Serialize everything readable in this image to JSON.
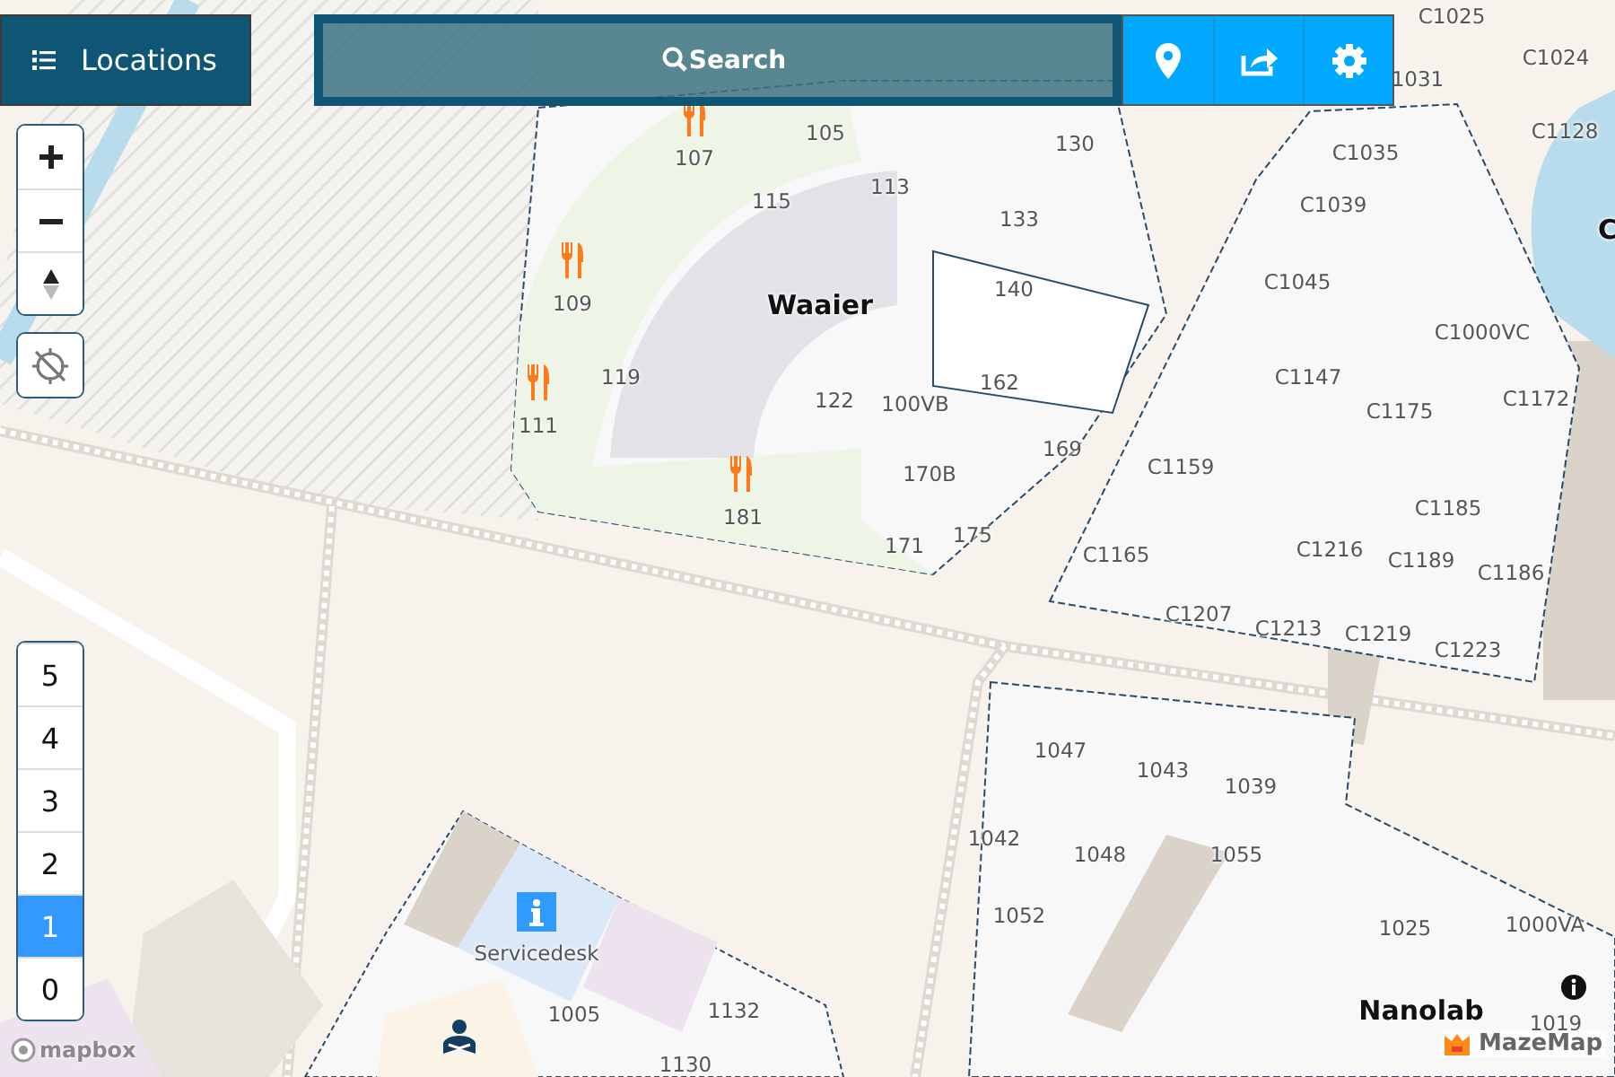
{
  "top_bar": {
    "locations_button": {
      "label": "Locations"
    },
    "search": {
      "placeholder": "Search"
    },
    "actions": [
      {
        "kind": "pin"
      },
      {
        "kind": "share"
      },
      {
        "kind": "settings"
      }
    ]
  },
  "zoom_controls": [
    {
      "kind": "zoom_in"
    },
    {
      "kind": "zoom_out"
    },
    {
      "kind": "compass"
    },
    {
      "kind": "locate"
    }
  ],
  "floors": [
    {
      "label": "5",
      "selected": false
    },
    {
      "label": "4",
      "selected": false
    },
    {
      "label": "3",
      "selected": false
    },
    {
      "label": "2",
      "selected": false
    },
    {
      "label": "1",
      "selected": true
    },
    {
      "label": "0",
      "selected": false
    }
  ],
  "map_labels": [
    {
      "text": "Waaier",
      "kind": "building"
    },
    {
      "text": "Nanolab",
      "kind": "building"
    },
    {
      "text": "C",
      "kind": "building"
    },
    {
      "text": "107",
      "kind": "room"
    },
    {
      "text": "105",
      "kind": "room"
    },
    {
      "text": "115",
      "kind": "room"
    },
    {
      "text": "113",
      "kind": "room"
    },
    {
      "text": "109",
      "kind": "room"
    },
    {
      "text": "119",
      "kind": "room"
    },
    {
      "text": "111",
      "kind": "room"
    },
    {
      "text": "122",
      "kind": "room"
    },
    {
      "text": "100VB",
      "kind": "room"
    },
    {
      "text": "181",
      "kind": "room"
    },
    {
      "text": "170B",
      "kind": "room"
    },
    {
      "text": "171",
      "kind": "room"
    },
    {
      "text": "175",
      "kind": "room"
    },
    {
      "text": "169",
      "kind": "room"
    },
    {
      "text": "162",
      "kind": "room"
    },
    {
      "text": "130",
      "kind": "room"
    },
    {
      "text": "133",
      "kind": "room"
    },
    {
      "text": "140",
      "kind": "room"
    },
    {
      "text": "C1025",
      "kind": "room"
    },
    {
      "text": "C1024",
      "kind": "room"
    },
    {
      "text": "1031",
      "kind": "room"
    },
    {
      "text": "C1128",
      "kind": "room"
    },
    {
      "text": "C1035",
      "kind": "room"
    },
    {
      "text": "C1039",
      "kind": "room"
    },
    {
      "text": "C1045",
      "kind": "room"
    },
    {
      "text": "C1000VC",
      "kind": "room"
    },
    {
      "text": "C1147",
      "kind": "room"
    },
    {
      "text": "C1175",
      "kind": "room"
    },
    {
      "text": "C1172",
      "kind": "room"
    },
    {
      "text": "C1159",
      "kind": "room"
    },
    {
      "text": "C1185",
      "kind": "room"
    },
    {
      "text": "C1165",
      "kind": "room"
    },
    {
      "text": "C1216",
      "kind": "room"
    },
    {
      "text": "C1189",
      "kind": "room"
    },
    {
      "text": "C1186",
      "kind": "room"
    },
    {
      "text": "C1207",
      "kind": "room"
    },
    {
      "text": "C1213",
      "kind": "room"
    },
    {
      "text": "C1219",
      "kind": "room"
    },
    {
      "text": "C1223",
      "kind": "room"
    },
    {
      "text": "1047",
      "kind": "room"
    },
    {
      "text": "1043",
      "kind": "room"
    },
    {
      "text": "1039",
      "kind": "room"
    },
    {
      "text": "1042",
      "kind": "room"
    },
    {
      "text": "1048",
      "kind": "room"
    },
    {
      "text": "1055",
      "kind": "room"
    },
    {
      "text": "1052",
      "kind": "room"
    },
    {
      "text": "1025",
      "kind": "room"
    },
    {
      "text": "1000VA",
      "kind": "room"
    },
    {
      "text": "1019",
      "kind": "room"
    },
    {
      "text": "1005",
      "kind": "room"
    },
    {
      "text": "1132",
      "kind": "room"
    },
    {
      "text": "1130",
      "kind": "room"
    },
    {
      "text": "Servicedesk",
      "kind": "poi"
    }
  ],
  "poi_markers": [
    {
      "kind": "restaurant"
    },
    {
      "kind": "restaurant"
    },
    {
      "kind": "restaurant"
    },
    {
      "kind": "restaurant"
    },
    {
      "kind": "info"
    },
    {
      "kind": "study"
    },
    {
      "kind": "info_small"
    }
  ],
  "attribution": {
    "mapbox": "mapbox",
    "mazemap": "MazeMap"
  }
}
